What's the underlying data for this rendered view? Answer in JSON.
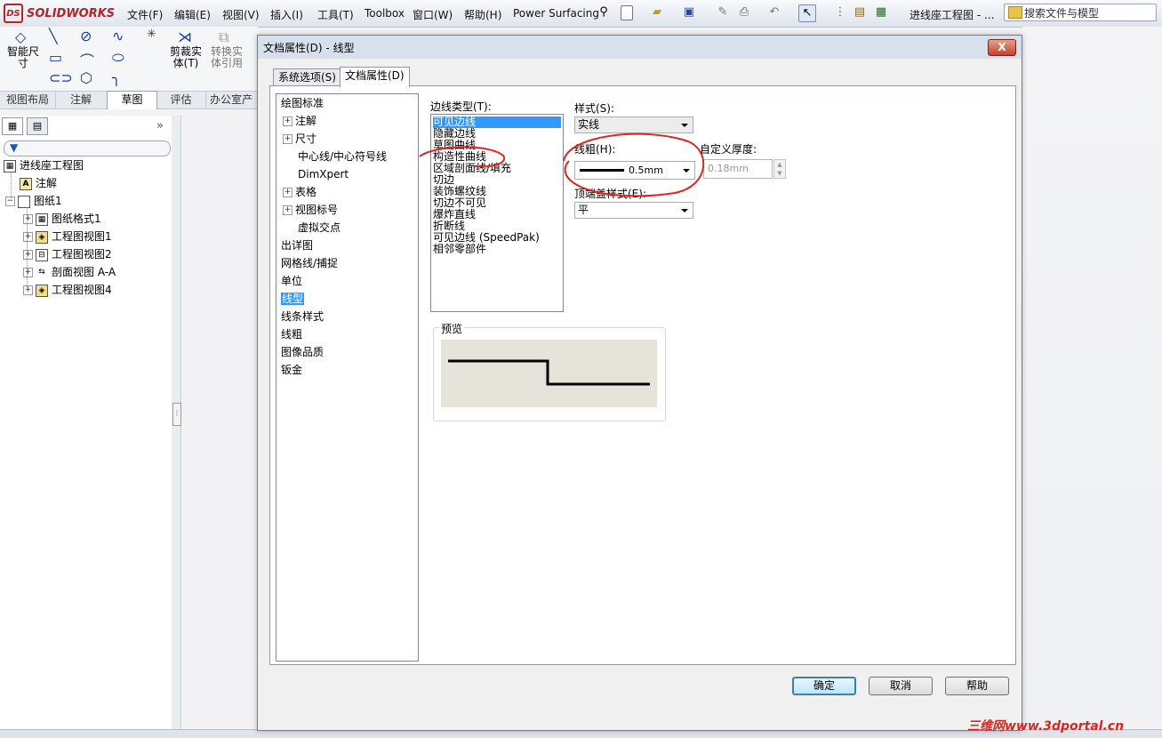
{
  "app": {
    "brand": "SOLIDWORKS",
    "menus": [
      "文件(F)",
      "编辑(E)",
      "视图(V)",
      "插入(I)",
      "工具(T)",
      "Toolbox",
      "窗口(W)",
      "帮助(H)",
      "Power Surfacing"
    ],
    "document_title": "进线座工程图 - ...",
    "search_placeholder": "搜索文件与模型"
  },
  "command_manager": {
    "smart_dim": "智能尺寸",
    "trim": "剪裁实体(T)",
    "convert": "转换实体引用",
    "tabs": [
      "视图布局",
      "注解",
      "草图",
      "评估",
      "办公室产"
    ]
  },
  "feature_tree": {
    "root": "进线座工程图",
    "items": [
      {
        "label": "注解",
        "indent": 1
      },
      {
        "label": "图纸1",
        "indent": 0
      },
      {
        "label": "图纸格式1",
        "indent": 2
      },
      {
        "label": "工程图视图1",
        "indent": 2
      },
      {
        "label": "工程图视图2",
        "indent": 2
      },
      {
        "label": "剖面视图 A-A",
        "indent": 2
      },
      {
        "label": "工程图视图4",
        "indent": 2
      }
    ]
  },
  "dialog": {
    "title": "文档属性(D) - 线型",
    "close_label": "X",
    "tabs": [
      "系统选项(S)",
      "文档属性(D)"
    ],
    "active_tab": 1,
    "categories": [
      "绘图标准",
      "注解",
      "尺寸",
      "中心线/中心符号线",
      "DimXpert",
      "表格",
      "视图标号",
      "虚拟交点",
      "出详图",
      "网格线/捕捉",
      "单位",
      "线型",
      "线条样式",
      "线粗",
      "图像品质",
      "钣金"
    ],
    "selected_category": "线型",
    "edge_type_label": "边线类型(T):",
    "edge_types": [
      "可见边线",
      "隐藏边线",
      "草图曲线",
      "构造性曲线",
      "区域剖面线/填充",
      "切边",
      "装饰螺纹线",
      "切边不可见",
      "爆炸直线",
      "折断线",
      "可见边线 (SpeedPak)",
      "相邻零部件"
    ],
    "selected_edge_type": "可见边线",
    "style_label": "样式(S):",
    "style_value": "实线",
    "thickness_label": "线粗(H):",
    "thickness_value": "0.5mm",
    "custom_thickness_label": "自定义厚度:",
    "custom_thickness_value": "0.18mm",
    "end_cap_label": "顶端盖样式(E):",
    "end_cap_value": "平",
    "preview_label": "预览",
    "buttons": {
      "ok": "确定",
      "cancel": "取消",
      "help": "帮助"
    }
  },
  "annotation_color": "#e0241f",
  "watermark": "三维网www.3dportal.cn"
}
